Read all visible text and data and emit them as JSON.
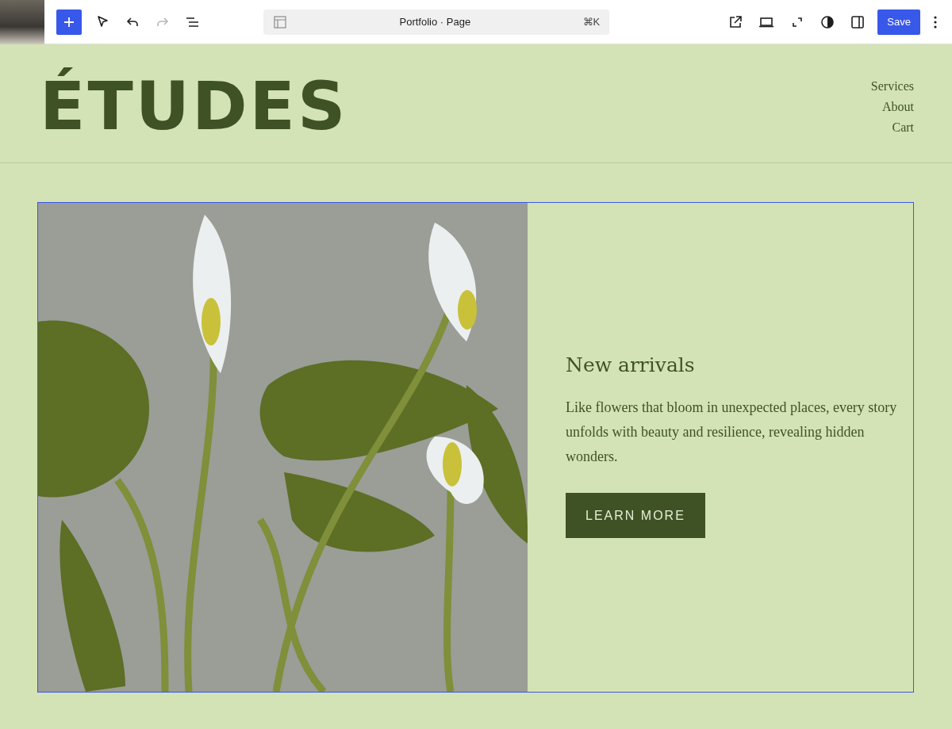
{
  "toolbar": {
    "document_title": "Portfolio · Page",
    "shortcut": "⌘K",
    "redo": {
      "disabled": true
    },
    "save_label": "Save"
  },
  "site": {
    "title": "ÉTUDES",
    "nav": [
      {
        "label": "Services"
      },
      {
        "label": "About"
      },
      {
        "label": "Cart"
      }
    ]
  },
  "hero": {
    "selected": true,
    "heading": "New arrivals",
    "text": "Like flowers that bloom in unexpected places, every story unfolds with beauty and resilience, revealing hidden wonders.",
    "button": "LEARN MORE"
  }
}
